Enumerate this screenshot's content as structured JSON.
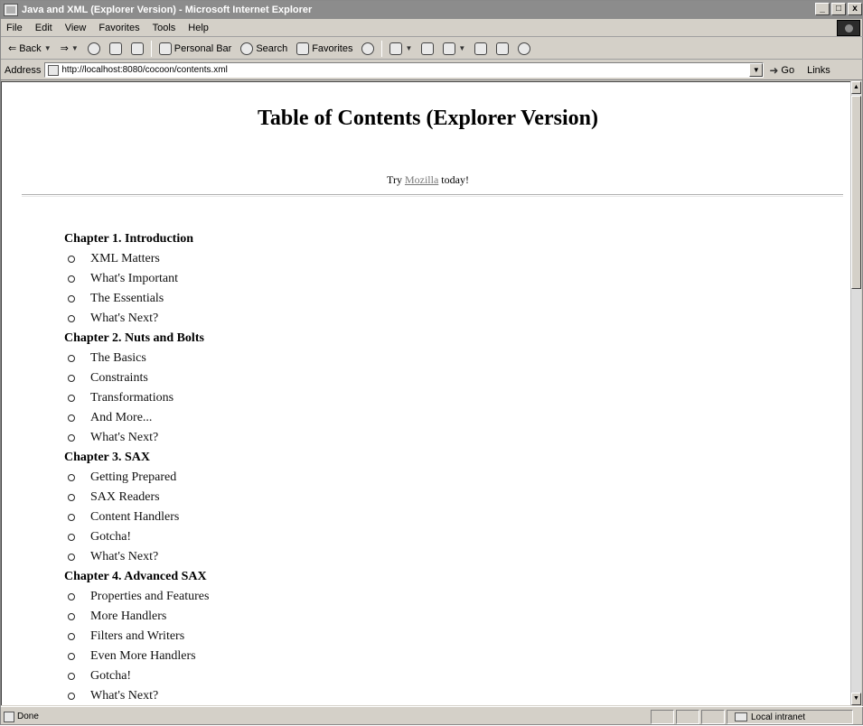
{
  "window": {
    "title": "Java and XML (Explorer Version) - Microsoft Internet Explorer",
    "controls": [
      "_",
      "□",
      "x"
    ]
  },
  "menu": [
    "File",
    "Edit",
    "View",
    "Favorites",
    "Tools",
    "Help"
  ],
  "toolbar": {
    "back": "Back",
    "personal_bar": "Personal Bar",
    "search": "Search",
    "favorites": "Favorites"
  },
  "address": {
    "label": "Address",
    "url": "http://localhost:8080/cocoon/contents.xml",
    "go": "Go",
    "links": "Links"
  },
  "page": {
    "title": "Table of Contents (Explorer Version)",
    "promo_before": "Try ",
    "promo_link": "Mozilla",
    "promo_after": " today!",
    "chapters": [
      {
        "title": "Chapter 1. Introduction",
        "sections": [
          "XML Matters",
          "What's Important",
          "The Essentials",
          "What's Next?"
        ]
      },
      {
        "title": "Chapter 2. Nuts and Bolts",
        "sections": [
          "The Basics",
          "Constraints",
          "Transformations",
          "And More...",
          "What's Next?"
        ]
      },
      {
        "title": "Chapter 3. SAX",
        "sections": [
          "Getting Prepared",
          "SAX Readers",
          "Content Handlers",
          "Gotcha!",
          "What's Next?"
        ]
      },
      {
        "title": "Chapter 4. Advanced SAX",
        "sections": [
          "Properties and Features",
          "More Handlers",
          "Filters and Writers",
          "Even More Handlers",
          "Gotcha!",
          "What's Next?"
        ]
      }
    ]
  },
  "status": {
    "text": "Done",
    "zone": "Local intranet"
  },
  "icons": [
    "ie-page-icon",
    "back-arrow-icon",
    "forward-arrow-icon",
    "stop-icon",
    "refresh-icon",
    "home-icon",
    "personal-bar-icon",
    "search-icon",
    "favorites-icon",
    "history-icon",
    "mail-icon",
    "print-icon",
    "edit-icon",
    "discuss-icon",
    "messenger-icon",
    "go-arrow-icon",
    "intranet-zone-icon"
  ]
}
